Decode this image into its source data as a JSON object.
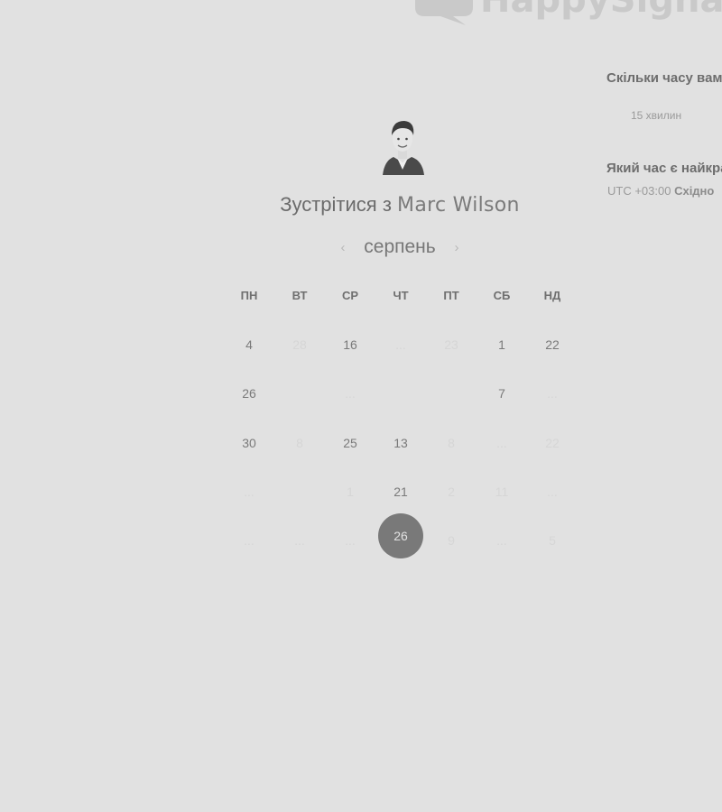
{
  "brand": {
    "logo_text": "HappySignals"
  },
  "questions": {
    "duration_title": "Скільки часу вам",
    "duration_option": "15 хвилин",
    "time_title": "Який час є найкращ",
    "timezone_prefix": "UTC +03:00",
    "timezone_name": "Східно"
  },
  "host": {
    "meet_prefix": "Зустрітися з",
    "name": "Marc Wilson"
  },
  "calendar": {
    "month": "серпень",
    "prev_label": "‹",
    "next_label": "›",
    "weekdays": [
      "ПН",
      "ВТ",
      "СР",
      "ЧТ",
      "ПТ",
      "СБ",
      "НД"
    ],
    "rows": [
      [
        "4",
        "28",
        "16",
        "...",
        "23",
        "1",
        "22"
      ],
      [
        "26",
        "",
        "...",
        "",
        "",
        "7",
        "..."
      ],
      [
        "30",
        "8",
        "25",
        "13",
        "8",
        "...",
        "22"
      ],
      [
        "...",
        "",
        "1",
        "21",
        "2",
        "11",
        "..."
      ],
      [
        "...",
        "...",
        "...",
        "26",
        "9",
        "...",
        "5"
      ]
    ],
    "active_mask": [
      [
        true,
        false,
        true,
        false,
        false,
        true,
        true
      ],
      [
        true,
        false,
        false,
        false,
        false,
        true,
        false
      ],
      [
        true,
        false,
        true,
        true,
        false,
        false,
        false
      ],
      [
        false,
        false,
        false,
        true,
        false,
        false,
        false
      ],
      [
        false,
        false,
        false,
        true,
        false,
        false,
        false
      ]
    ],
    "selected_day": "26"
  }
}
